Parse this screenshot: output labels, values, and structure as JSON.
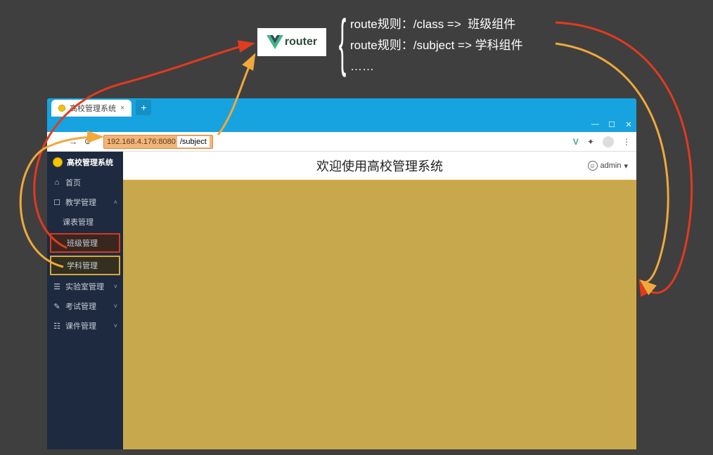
{
  "router_badge": {
    "label": "router"
  },
  "rules": {
    "line1": "route规则：/class =>  班级组件",
    "line2": "route规则：/subject => 学科组件",
    "line3": "……"
  },
  "browser": {
    "tab_title": "高校管理系统",
    "tab_close": "×",
    "add_tab": "+",
    "win_min": "—",
    "win_max": "☐",
    "win_close": "✕",
    "nav_back": "←",
    "nav_fwd": "→",
    "nav_reload": "⟳",
    "url_host": "192.168.4.176:8080",
    "url_path": "/subject",
    "ext_icon": "✦",
    "menu_icon": "⋮"
  },
  "app": {
    "title": "高校管理系统",
    "welcome": "欢迎使用高校管理系统",
    "user": "admin",
    "user_caret": "▾"
  },
  "sidebar": {
    "home": {
      "icon": "⌂",
      "label": "首页"
    },
    "teach": {
      "icon": "☐",
      "label": "教学管理",
      "chev": "˄"
    },
    "schedule": {
      "label": "课表管理"
    },
    "class": {
      "label": "班级管理"
    },
    "subject": {
      "label": "学科管理"
    },
    "lab": {
      "icon": "☰",
      "label": "实验室管理",
      "chev": "˅"
    },
    "exam": {
      "icon": "✎",
      "label": "考试管理",
      "chev": "˅"
    },
    "courseware": {
      "icon": "☷",
      "label": "课件管理",
      "chev": "˅"
    }
  }
}
